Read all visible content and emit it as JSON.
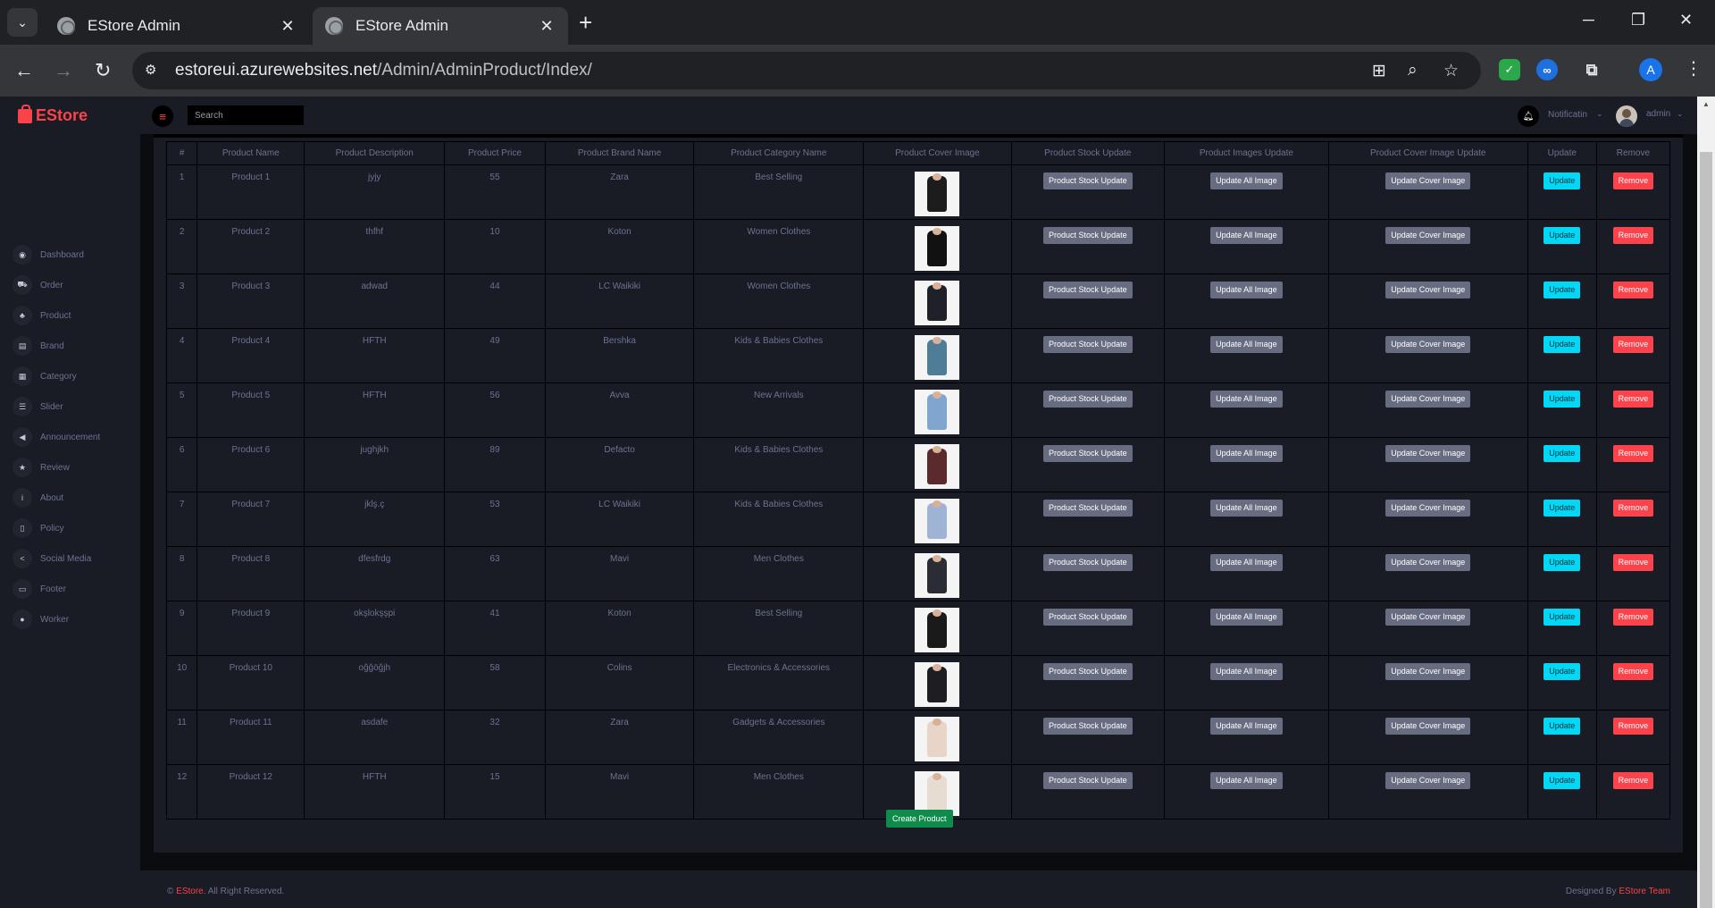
{
  "browser": {
    "tabs": [
      {
        "title": "EStore Admin",
        "active": false
      },
      {
        "title": "EStore Admin",
        "active": true
      }
    ],
    "url_host": "estoreui.azurewebsites.net",
    "url_path": "/Admin/AdminProduct/Index/",
    "profile_initial": "A"
  },
  "sidebar": {
    "brand": "EStore",
    "items": [
      {
        "label": "Dashboard",
        "icon": "dashboard-icon",
        "glyph": "◉"
      },
      {
        "label": "Order",
        "icon": "cart-icon",
        "glyph": "⛟"
      },
      {
        "label": "Product",
        "icon": "product-icon",
        "glyph": "♣"
      },
      {
        "label": "Brand",
        "icon": "brand-icon",
        "glyph": "▤"
      },
      {
        "label": "Category",
        "icon": "category-icon",
        "glyph": "▦"
      },
      {
        "label": "Slider",
        "icon": "slider-icon",
        "glyph": "☰"
      },
      {
        "label": "Announcement",
        "icon": "megaphone-icon",
        "glyph": "◀"
      },
      {
        "label": "Review",
        "icon": "star-icon",
        "glyph": "★"
      },
      {
        "label": "About",
        "icon": "info-icon",
        "glyph": "i"
      },
      {
        "label": "Policy",
        "icon": "policy-icon",
        "glyph": "▯"
      },
      {
        "label": "Social Media",
        "icon": "share-icon",
        "glyph": "<"
      },
      {
        "label": "Footer",
        "icon": "footer-icon",
        "glyph": "▭"
      },
      {
        "label": "Worker",
        "icon": "user-icon",
        "glyph": "●"
      }
    ]
  },
  "topnav": {
    "search_placeholder": "Search",
    "notification_label": "Notificatin",
    "user_label": "admin"
  },
  "table": {
    "headers": [
      "#",
      "Product Name",
      "Product Description",
      "Product Price",
      "Product Brand Name",
      "Product Category Name",
      "Product Cover Image",
      "Product Stock Update",
      "Product Images Update",
      "Product Cover Image Update",
      "Update",
      "Remove"
    ],
    "rows": [
      {
        "no": "1",
        "name": "Product 1",
        "description": "jyjy",
        "price": "55",
        "brand": "Zara",
        "category": "Best Selling",
        "color": "#1c1c1c"
      },
      {
        "no": "2",
        "name": "Product 2",
        "description": "thfhf",
        "price": "10",
        "brand": "Koton",
        "category": "Women Clothes",
        "color": "#111111"
      },
      {
        "no": "3",
        "name": "Product 3",
        "description": "adwad",
        "price": "44",
        "brand": "LC Waikiki",
        "category": "Women Clothes",
        "color": "#202028"
      },
      {
        "no": "4",
        "name": "Product 4",
        "description": "HFTH",
        "price": "49",
        "brand": "Bershka",
        "category": "Kids & Babies Clothes",
        "color": "#4f7d98"
      },
      {
        "no": "5",
        "name": "Product 5",
        "description": "HFTH",
        "price": "56",
        "brand": "Avva",
        "category": "New Arrivals",
        "color": "#7ea6cf"
      },
      {
        "no": "6",
        "name": "Product 6",
        "description": "jughjkh",
        "price": "89",
        "brand": "Defacto",
        "category": "Kids & Babies Clothes",
        "color": "#5a2a2c"
      },
      {
        "no": "7",
        "name": "Product 7",
        "description": "jklş.ç",
        "price": "53",
        "brand": "LC Waikiki",
        "category": "Kids & Babies Clothes",
        "color": "#9fb3d4"
      },
      {
        "no": "8",
        "name": "Product 8",
        "description": "dfesfrdg",
        "price": "63",
        "brand": "Mavi",
        "category": "Men Clothes",
        "color": "#2a2d33"
      },
      {
        "no": "9",
        "name": "Product 9",
        "description": "okşlokşşpi",
        "price": "41",
        "brand": "Koton",
        "category": "Best Selling",
        "color": "#1a1a1a"
      },
      {
        "no": "10",
        "name": "Product 10",
        "description": "oğğöğjh",
        "price": "58",
        "brand": "Colins",
        "category": "Electronics & Accessories",
        "color": "#1e1e22"
      },
      {
        "no": "11",
        "name": "Product 11",
        "description": "asdafe",
        "price": "32",
        "brand": "Zara",
        "category": "Gadgets & Accessories",
        "color": "#e8d5c7"
      },
      {
        "no": "12",
        "name": "Product 12",
        "description": "HFTH",
        "price": "15",
        "brand": "Mavi",
        "category": "Men Clothes",
        "color": "#e6dcd2"
      }
    ],
    "buttons": {
      "stock": "Product Stock Update",
      "images": "Update All Image",
      "cover": "Update Cover Image",
      "update": "Update",
      "remove": "Remove"
    }
  },
  "create_button": "Create Product",
  "footer": {
    "copyright_symbol": "©",
    "brand": "EStore",
    "rights": ". All Right Reserved.",
    "designed_by": "Designed By",
    "team": "EStore Team"
  },
  "colors": {
    "accent": "#fc424a",
    "update": "#00d8f5",
    "create": "#0f8c4b",
    "panel": "#191c24"
  }
}
